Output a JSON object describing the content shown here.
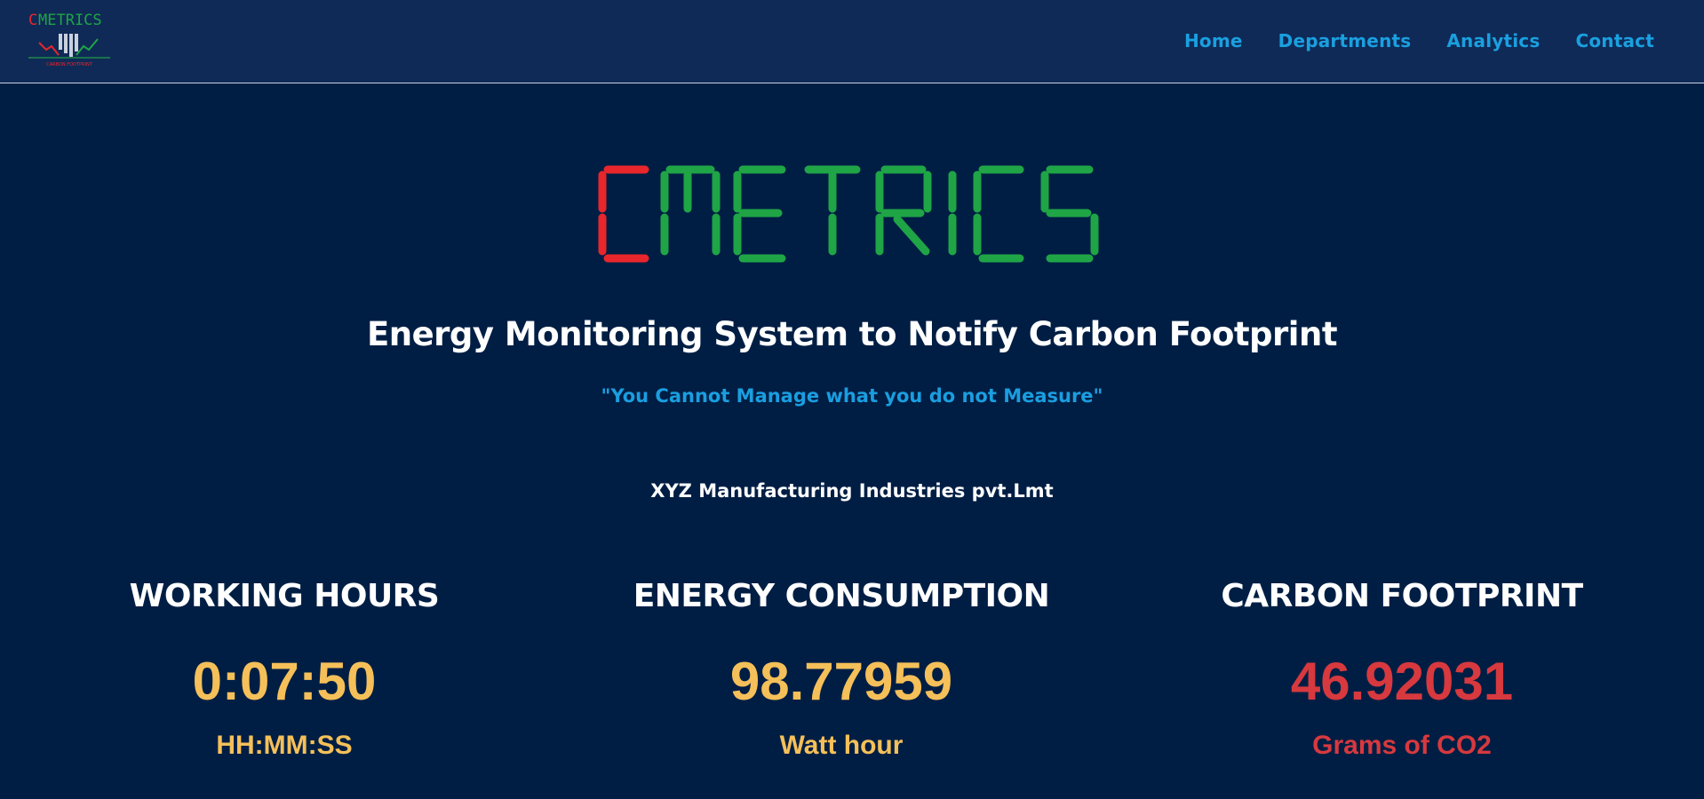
{
  "header": {
    "logo_text": "CMETRICS",
    "logo_tagline": "CARBON FOOTPRINT",
    "nav": [
      {
        "label": "Home"
      },
      {
        "label": "Departments"
      },
      {
        "label": "Analytics"
      },
      {
        "label": "Contact"
      }
    ]
  },
  "hero": {
    "logo_text": "CMETRICS",
    "title": "Energy Monitoring System to Notify Carbon Footprint",
    "quote": "\"You Cannot Manage what you do not Measure\"",
    "company": "XYZ Manufacturing Industries pvt.Lmt"
  },
  "metrics": [
    {
      "title": "WORKING HOURS",
      "value": "0:07:50",
      "unit": "HH:MM:SS"
    },
    {
      "title": "ENERGY CONSUMPTION",
      "value": "98.77959",
      "unit": "Watt hour"
    },
    {
      "title": "CARBON FOOTPRINT",
      "value": "46.92031",
      "unit": "Grams of CO2"
    }
  ],
  "colors": {
    "background": "#001e44",
    "navbar": "#0f2a57",
    "nav_link": "#1aa0e0",
    "logo_red": "#e8262b",
    "logo_green": "#1fa446",
    "value_yellow": "#f5c059",
    "value_red": "#d7393e"
  }
}
